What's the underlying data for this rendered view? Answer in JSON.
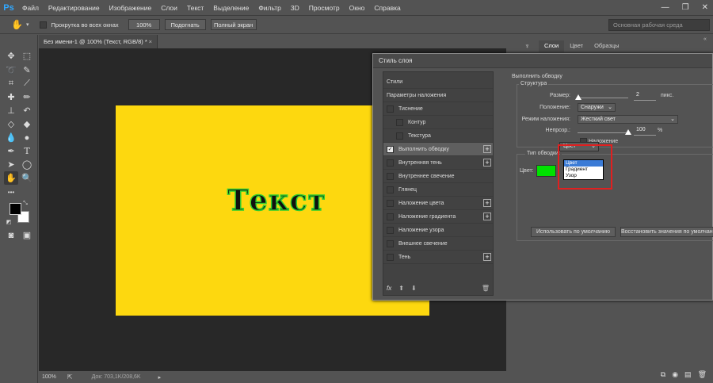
{
  "app": {
    "logo": "Ps"
  },
  "menu": [
    "Файл",
    "Редактирование",
    "Изображение",
    "Слои",
    "Текст",
    "Выделение",
    "Фильтр",
    "3D",
    "Просмотр",
    "Окно",
    "Справка"
  ],
  "window_controls": {
    "minimize": "—",
    "restore": "❐",
    "close": "✕"
  },
  "options_bar": {
    "scroll_all_label": "Прокрутка во всех окнах",
    "zoom_value": "100%",
    "fit_label": "Подогнать",
    "fullscreen_label": "Полный экран",
    "workspace_placeholder": "Основная рабочая среда"
  },
  "document": {
    "tab_title": "Без имени-1 @ 100% (Текст, RGB/8) *",
    "tab_close": "×",
    "canvas_text": "Текст",
    "canvas_bg": "#fdd80f",
    "stroke_color": "#31d02e"
  },
  "status": {
    "zoom": "100%",
    "doc_info": "Док: 703,1K/208,6K"
  },
  "panels": {
    "tabs": [
      "Слои",
      "Цвет",
      "Образцы"
    ]
  },
  "dialog": {
    "title": "Стиль слоя",
    "styles": [
      {
        "label": "Стили",
        "checkbox": false,
        "plus": false,
        "selected": false,
        "indent": 0
      },
      {
        "label": "Параметры наложения",
        "checkbox": false,
        "plus": false,
        "selected": false,
        "indent": 0
      },
      {
        "label": "Тиснение",
        "checkbox": true,
        "checked": false,
        "plus": false,
        "selected": false,
        "indent": 0
      },
      {
        "label": "Контур",
        "checkbox": true,
        "checked": false,
        "plus": false,
        "selected": false,
        "indent": 1
      },
      {
        "label": "Текстура",
        "checkbox": true,
        "checked": false,
        "plus": false,
        "selected": false,
        "indent": 1
      },
      {
        "label": "Выполнить обводку",
        "checkbox": true,
        "checked": true,
        "plus": true,
        "selected": true,
        "indent": 0
      },
      {
        "label": "Внутренняя тень",
        "checkbox": true,
        "checked": false,
        "plus": true,
        "selected": false,
        "indent": 0
      },
      {
        "label": "Внутреннее свечение",
        "checkbox": true,
        "checked": false,
        "plus": false,
        "selected": false,
        "indent": 0
      },
      {
        "label": "Глянец",
        "checkbox": true,
        "checked": false,
        "plus": false,
        "selected": false,
        "indent": 0
      },
      {
        "label": "Наложение цвета",
        "checkbox": true,
        "checked": false,
        "plus": true,
        "selected": false,
        "indent": 0
      },
      {
        "label": "Наложение градиента",
        "checkbox": true,
        "checked": false,
        "plus": true,
        "selected": false,
        "indent": 0
      },
      {
        "label": "Наложение узора",
        "checkbox": true,
        "checked": false,
        "plus": false,
        "selected": false,
        "indent": 0
      },
      {
        "label": "Внешнее свечение",
        "checkbox": true,
        "checked": false,
        "plus": false,
        "selected": false,
        "indent": 0
      },
      {
        "label": "Тень",
        "checkbox": true,
        "checked": false,
        "plus": true,
        "selected": false,
        "indent": 0
      }
    ],
    "footer_fx": "fx",
    "stroke": {
      "section_title": "Выполнить обводку",
      "structure_title": "Структура",
      "size_label": "Размер:",
      "size_value": "2",
      "size_unit": "пикс.",
      "position_label": "Положение:",
      "position_value": "Снаружи",
      "blend_label": "Режим наложения:",
      "blend_value": "Жесткий свет",
      "opacity_label": "Непрозр.:",
      "opacity_value": "100",
      "opacity_unit": "%",
      "overprint_label": "Наложение",
      "fill_type_label": "Тип обводки:",
      "fill_type_value": "Цвет",
      "fill_type_options": [
        "Цвет",
        "Градиент",
        "Узор"
      ],
      "color_label": "Цвет:",
      "color_value": "#00e100",
      "default_btn": "Использовать по умолчанию",
      "restore_btn": "Восстановить значения по умолчанию"
    }
  }
}
